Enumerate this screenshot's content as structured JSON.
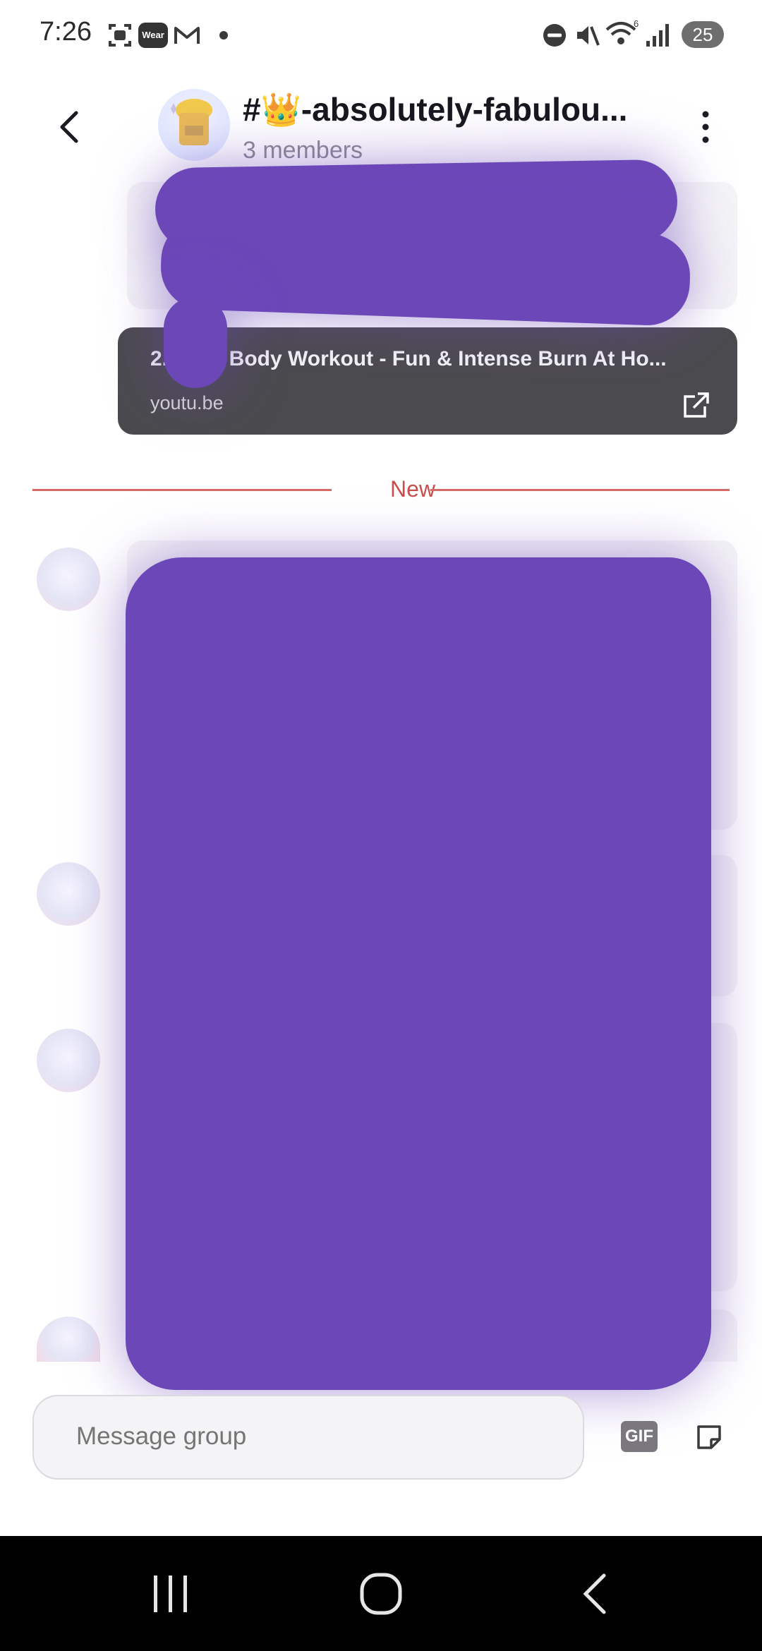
{
  "status_bar": {
    "time": "7:26",
    "wear_label": "Wear",
    "wifi_badge": "6",
    "battery": "25"
  },
  "header": {
    "title": "#👑-absolutely-fabulou...",
    "subtitle": "3 members"
  },
  "link_preview": {
    "title": "2... Full Body Workout - Fun & Intense Burn At Ho...",
    "domain": "youtu.be"
  },
  "divider": {
    "label": "New"
  },
  "composer": {
    "placeholder": "Message group",
    "gif_label": "GIF"
  },
  "colors": {
    "accent_new": "#c94f4f",
    "redaction": "#6c47b8",
    "link_card": "#4b4a4e"
  }
}
